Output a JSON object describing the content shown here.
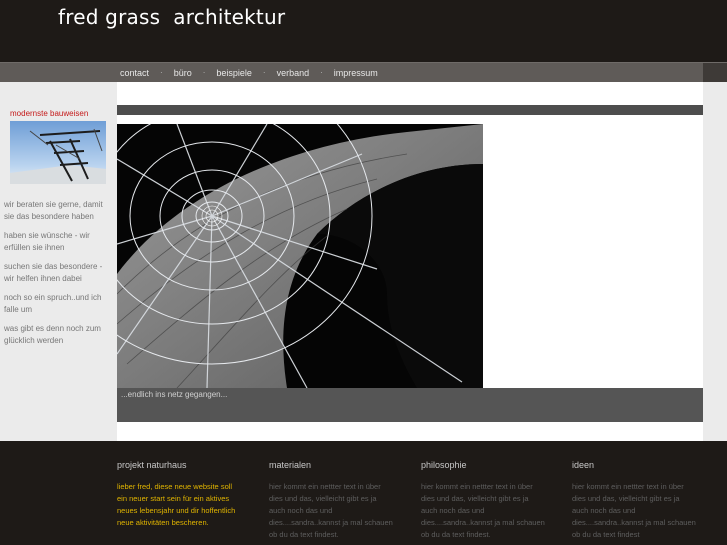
{
  "header": {
    "title": "fred grass  architektur"
  },
  "nav": {
    "items": [
      {
        "label": "contact"
      },
      {
        "label": "büro"
      },
      {
        "label": "beispiele"
      },
      {
        "label": "verband"
      },
      {
        "label": "impressum"
      }
    ],
    "separator": "·"
  },
  "sidebar": {
    "heading": "modernste bauweisen",
    "links": [
      {
        "text": "wir beraten sie gerne, damit sie das besondere haben"
      },
      {
        "text": "haben sie wünsche - wir erfüllen sie ihnen"
      },
      {
        "text": "suchen sie das besondere - wir helfen ihnen dabei"
      },
      {
        "text": "noch so ein spruch..und ich falle um"
      },
      {
        "text": "was gibt es denn noch zum glücklich werden"
      }
    ]
  },
  "main": {
    "caption": "...endlich ins netz gegangen..."
  },
  "footer": {
    "columns": [
      {
        "title": "projekt naturhaus",
        "text": "lieber fred, diese neue website soll ein neuer start sein für ein aktives neues lebensjahr und dir hoffentlich neue aktivitäten bescheren."
      },
      {
        "title": "materialen",
        "text": "hier kommt ein nettter text in über dies und das, vielleicht gibt es ja auch noch das und dies....sandra..kannst ja mal schauen ob du da text findest."
      },
      {
        "title": "philosophie",
        "text": "hier kommt ein nettter text in über dies und das, vielleicht gibt es ja auch noch das und dies....sandra..kannst ja mal schauen ob du da text findest."
      },
      {
        "title": "ideen",
        "text": "hier kommt ein nettter text in über dies und das, vielleicht gibt es ja auch noch das und dies....sandra..kannst ja mal schauen ob du da text findest"
      }
    ]
  },
  "colors": {
    "header_bg": "#1e1a17",
    "nav_bg": "#5f5b58",
    "sidebar_heading": "#c41a1a",
    "footer_highlight": "#e0b400"
  }
}
